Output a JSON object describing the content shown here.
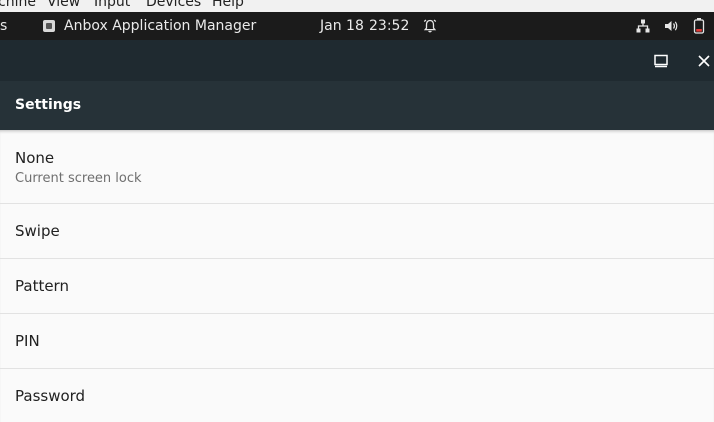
{
  "host_menu": {
    "items": [
      "chine",
      "View",
      "Input",
      "Devices",
      "Help"
    ]
  },
  "top_bar": {
    "left_label": "s",
    "app_name": "Anbox Application Manager",
    "date": "Jan 18",
    "time": "23:52",
    "icons": [
      "alarm-bell-icon",
      "network-icon",
      "volume-icon",
      "battery-icon"
    ]
  },
  "window": {
    "buttons": [
      "restore-icon",
      "close-icon"
    ]
  },
  "toolbar": {
    "title": "Settings"
  },
  "screen_lock": {
    "items": [
      {
        "label": "None",
        "sublabel": "Current screen lock"
      },
      {
        "label": "Swipe"
      },
      {
        "label": "Pattern"
      },
      {
        "label": "PIN"
      },
      {
        "label": "Password"
      }
    ]
  },
  "colors": {
    "top_bar": "#1b1b1b",
    "window_titlebar": "#1f2a30",
    "toolbar": "#263238",
    "list_background": "#fafafa",
    "divider": "#e2e2e2"
  }
}
